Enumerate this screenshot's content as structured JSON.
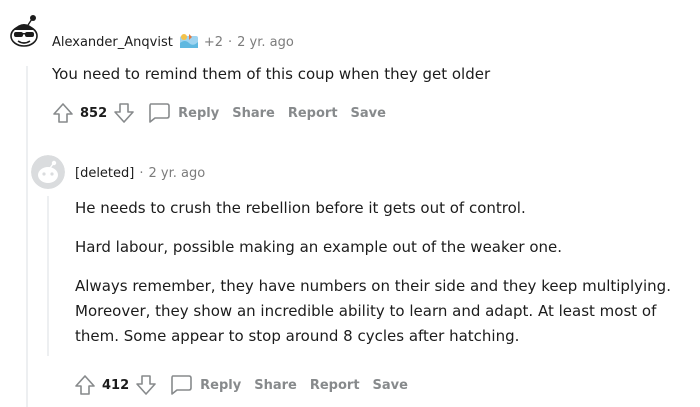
{
  "comments": [
    {
      "username": "Alexander_Anqvist",
      "flair_count": "+2",
      "separator": "·",
      "time": "2 yr. ago",
      "body": [
        "You need to remind them of this coup when they get older"
      ],
      "score": "852",
      "actions": {
        "reply": "Reply",
        "share": "Share",
        "report": "Report",
        "save": "Save"
      }
    },
    {
      "username": "[deleted]",
      "separator": "·",
      "time": "2 yr. ago",
      "body": [
        "He needs to crush the rebellion before it gets out of control.",
        "Hard labour, possible making an example out of the weaker one.",
        "Always remember, they have numbers on their side and they keep multiplying. Moreover, they show an incredible ability to learn and adapt. At least most of them. Some appear to stop around 8 cycles after hatching."
      ],
      "score": "412",
      "actions": {
        "reply": "Reply",
        "share": "Share",
        "report": "Report",
        "save": "Save"
      }
    }
  ],
  "colors": {
    "text": "#1c1c1c",
    "meta": "#7c7c7c",
    "action": "#878a8c",
    "thread": "#edeff1"
  }
}
